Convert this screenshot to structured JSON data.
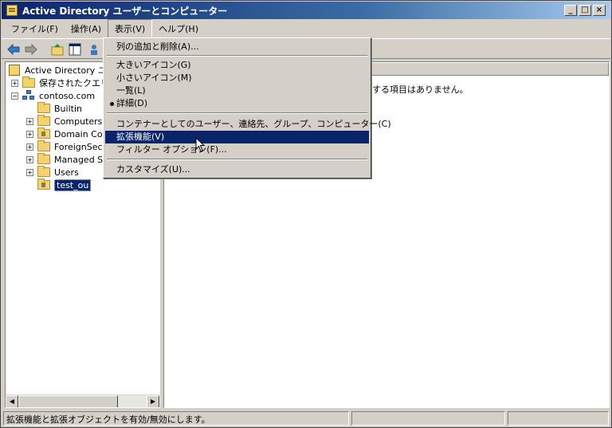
{
  "window": {
    "title": "Active Directory ユーザーとコンピューター",
    "controls": {
      "minimize": "_",
      "maximize": "□",
      "close": "×"
    }
  },
  "menubar": {
    "items": [
      "ファイル(F)",
      "操作(A)",
      "表示(V)",
      "ヘルプ(H)"
    ],
    "active_index": 2
  },
  "toolbar": {
    "icons": [
      "back-arrow-icon",
      "forward-arrow-icon",
      "up-folder-icon",
      "show-hide-tree-icon",
      "users-icon"
    ]
  },
  "tree": {
    "root": "Active Directory ユ",
    "saved_queries": "保存されたクエリ",
    "domain": "contoso.com",
    "children": [
      "Builtin",
      "Computers",
      "Domain Cor",
      "ForeignSecu",
      "Managed Se",
      "Users",
      "test_ou"
    ],
    "selected": "test_ou"
  },
  "list_view": {
    "empty_message": "する項目はありません。"
  },
  "view_menu": {
    "items": [
      {
        "label": "列の追加と削除(A)..."
      },
      {
        "label": "大きいアイコン(G)"
      },
      {
        "label": "小さいアイコン(M)"
      },
      {
        "label": "一覧(L)"
      },
      {
        "label": "詳細(D)",
        "checked": true
      },
      {
        "label": "コンテナーとしてのユーザー、連絡先、グループ、コンピューター(C)"
      },
      {
        "label": "拡張機能(V)",
        "highlighted": true
      },
      {
        "label": "フィルター オプション(F)..."
      },
      {
        "label": "カスタマイズ(U)..."
      }
    ]
  },
  "statusbar": {
    "text": "拡張機能と拡張オブジェクトを有効/無効にします。"
  },
  "colors": {
    "selection": "#0a246a",
    "titlebar_start": "#0a246a",
    "titlebar_end": "#a6caf0",
    "face": "#d4d0c8"
  }
}
